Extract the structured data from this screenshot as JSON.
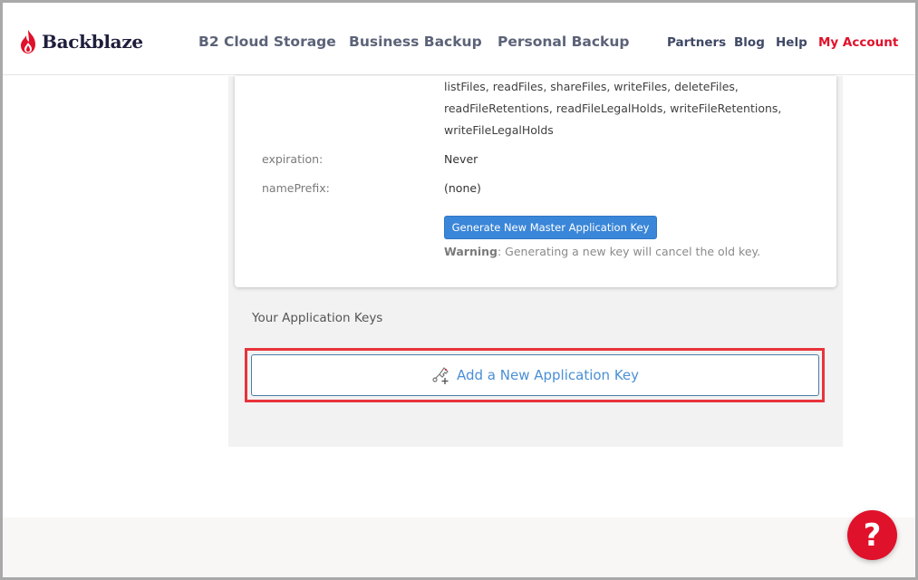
{
  "header": {
    "logo_text": "Backblaze",
    "nav_main": [
      "B2 Cloud Storage",
      "Business Backup",
      "Personal Backup"
    ],
    "nav_secondary": [
      "Partners",
      "Blog",
      "Help",
      "My Account"
    ]
  },
  "master_key": {
    "capabilities_lines": [
      "listFiles, readFiles, shareFiles, writeFiles, deleteFiles,",
      "readFileRetentions, readFileLegalHolds, writeFileRetentions,",
      "writeFileLegalHolds"
    ],
    "expiration_label": "expiration:",
    "expiration_value": "Never",
    "name_prefix_label": "namePrefix:",
    "name_prefix_value": "(none)",
    "generate_button": "Generate New Master Application Key",
    "warning_strong": "Warning",
    "warning_text": ": Generating a new key will cancel the old key."
  },
  "app_keys": {
    "title": "Your Application Keys",
    "add_button": "Add a New Application Key"
  },
  "help_button": "?",
  "colors": {
    "brand_red": "#e0112b",
    "primary_blue": "#3a86d8",
    "link_blue": "#4a8fd6",
    "highlight_red": "#e8333c"
  }
}
